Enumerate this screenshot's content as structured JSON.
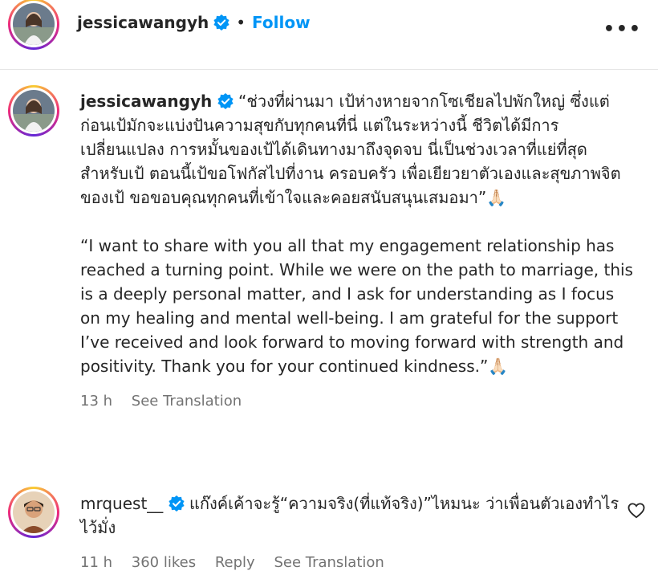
{
  "post": {
    "author": "jessicawangyh",
    "follow_label": "Follow",
    "separator": "•",
    "more_label": "•••"
  },
  "caption": {
    "author": "jessicawangyh",
    "thai_text": "“ช่วงที่ผ่านมา เป้ห่างหายจากโซเชียลไปพักใหญ่ ซึ่งแต่ก่อนเป้มักจะแบ่งปันความสุขกับทุกคนที่นี่ แต่ในระหว่างนี้ ชีวิตได้มีการเปลี่ยนแปลง การหมั้นของเป้ได้เดินทางมาถึงจุดจบ นี่เป็นช่วงเวลาที่แย่ที่สุดสำหรับเป้ ตอนนี้เป้ขอโฟกัสไปที่งาน ครอบครัว เพื่อเยียวยาตัวเองและสุขภาพจิตของเป้ ขอขอบคุณทุกคนที่เข้าใจและคอยสนับสนุนเสมอมา”",
    "thai_emoji": "🙏🏻",
    "english_text": "“I want to share with you all that my engagement relationship has reached a turning point. While we were on the path to marriage, this is a deeply personal matter, and I ask for understanding as I focus on my healing and mental well-being. I am grateful for the support I’ve received and look forward to moving forward with strength and positivity. Thank you for your continued kindness.”",
    "english_emoji": "🙏🏻",
    "time": "13 h",
    "see_translation": "See Translation"
  },
  "comment": {
    "author": "mrquest__",
    "text": "แก๊งค์เค้าจะรู้“ความจริง(ที่แท้จริง)”ไหมนะ ว่าเพื่อนตัวเองทำไรไว้มั่ง",
    "time": "11 h",
    "likes": "360 likes",
    "reply": "Reply",
    "see_translation": "See Translation"
  },
  "colors": {
    "accent": "#0095f6",
    "verified": "#0095f6",
    "meta": "#737373"
  },
  "icons": [
    "verified-badge-icon",
    "more-options-icon",
    "heart-icon",
    "prayer-hands-emoji"
  ]
}
